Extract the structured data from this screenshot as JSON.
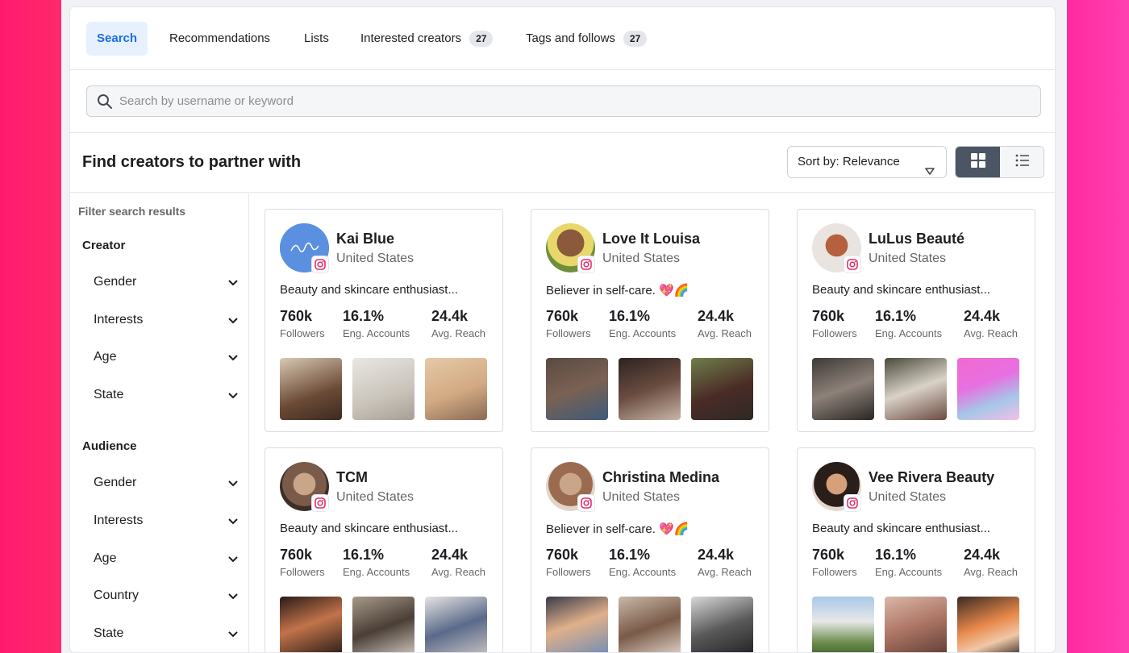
{
  "tabs": [
    {
      "label": "Search",
      "active": true
    },
    {
      "label": "Recommendations"
    },
    {
      "label": "Lists"
    },
    {
      "label": "Interested creators",
      "count": "27"
    },
    {
      "label": "Tags and follows",
      "count": "27"
    }
  ],
  "search": {
    "placeholder": "Search by username or keyword",
    "icon": "search-icon"
  },
  "header": {
    "title": "Find creators to partner with",
    "sort_label": "Sort by: Relevance",
    "view_modes": [
      "grid-view-icon",
      "list-view-icon"
    ]
  },
  "sidebar": {
    "title": "Filter search results",
    "sections": [
      {
        "title": "Creator",
        "items": [
          "Gender",
          "Interests",
          "Age",
          "State"
        ]
      },
      {
        "title": "Audience",
        "items": [
          "Gender",
          "Interests",
          "Age",
          "Country",
          "State"
        ]
      }
    ]
  },
  "stat_labels": {
    "followers": "Followers",
    "engagement": "Eng. Accounts",
    "reach": "Avg. Reach"
  },
  "creators": [
    {
      "name": "Kai Blue",
      "location": "United States",
      "bio": "Beauty and skincare enthusiast...",
      "followers": "760k",
      "engagement": "16.1%",
      "reach": "24.4k"
    },
    {
      "name": "Love It Louisa",
      "location": "United States",
      "bio": "Believer in self-care. 💖🌈",
      "followers": "760k",
      "engagement": "16.1%",
      "reach": "24.4k"
    },
    {
      "name": "LuLus Beauté",
      "location": "United States",
      "bio": "Beauty and skincare enthusiast...",
      "followers": "760k",
      "engagement": "16.1%",
      "reach": "24.4k"
    },
    {
      "name": "TCM",
      "location": "United States",
      "bio": "Beauty and skincare enthusiast...",
      "followers": "760k",
      "engagement": "16.1%",
      "reach": "24.4k"
    },
    {
      "name": "Christina Medina",
      "location": "United States",
      "bio": "Believer in self-care. 💖🌈",
      "followers": "760k",
      "engagement": "16.1%",
      "reach": "24.4k"
    },
    {
      "name": "Vee Rivera Beauty",
      "location": "United States",
      "bio": "Beauty and skincare enthusiast...",
      "followers": "760k",
      "engagement": "16.1%",
      "reach": "24.4k"
    }
  ],
  "colors": {
    "accent": "#1b6ee6",
    "tab_active_bg": "#e7f0fd",
    "instagram": "#e1306c"
  }
}
